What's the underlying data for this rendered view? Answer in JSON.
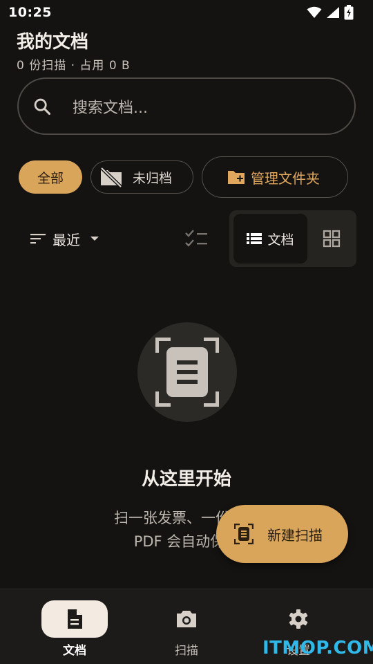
{
  "status_bar": {
    "time": "10:25"
  },
  "header": {
    "title": "我的文档",
    "subtitle": "0  份扫描  ·  占用  0  B"
  },
  "search": {
    "placeholder": "搜索文档..."
  },
  "filters": {
    "all": "全部",
    "unfiled": "未归档",
    "manage_folders": "管理文件夹"
  },
  "toolbar": {
    "sort_label": "最近",
    "view_docs_label": "文档"
  },
  "empty_state": {
    "title": "从这里开始",
    "desc_line1": "扫一张发票、一份合同",
    "desc_line2": "PDF 会自动保存"
  },
  "fab": {
    "label": "新建扫描"
  },
  "bottom_nav": {
    "items": [
      {
        "label": "文档",
        "icon": "document-icon",
        "active": true
      },
      {
        "label": "扫描",
        "icon": "camera-icon",
        "active": false
      },
      {
        "label": "设置",
        "icon": "gear-icon",
        "active": false
      }
    ]
  },
  "watermark": "ITMOP.COM",
  "colors": {
    "accent": "#d9a55b",
    "background": "#141312",
    "folder_accent": "#e1a75c"
  }
}
